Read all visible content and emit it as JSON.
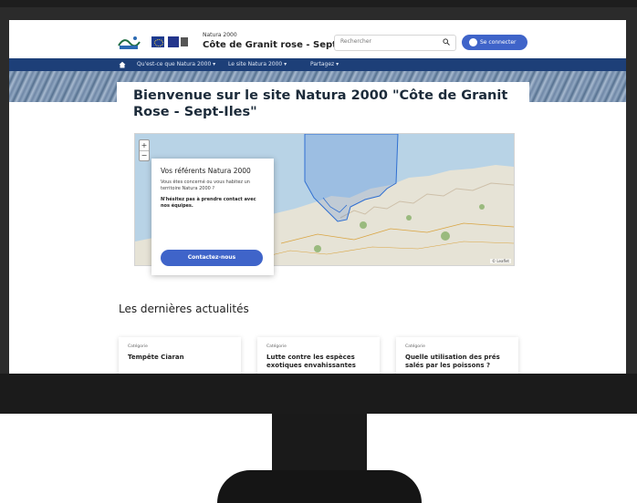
{
  "site": {
    "kicker": "Natura 2000",
    "name": "Côte de Granit rose - Sept-Iles",
    "search_placeholder": "Rechercher",
    "login_label": "Se connecter"
  },
  "nav": {
    "items": [
      "Qu'est-ce que Natura 2000 ▾",
      "Le site Natura 2000 ▾",
      "Partagez ▾"
    ]
  },
  "main": {
    "title": "Bienvenue sur le site Natura 2000 \"Côte de Granit Rose - Sept-Iles\""
  },
  "map": {
    "zoom_in": "+",
    "zoom_out": "−",
    "attribution": "© Leaflet",
    "popup": {
      "title": "Vos référents Natura 2000",
      "text": "Vous êtes concerné ou vous habitez un territoire Natura 2000 ?",
      "strong": "N'hésitez pas à prendre contact avec nos équipes.",
      "button": "Contactez-nous"
    }
  },
  "news": {
    "title": "Les dernières actualités",
    "items": [
      {
        "category": "Catégorie",
        "headline": "Tempête Ciaran"
      },
      {
        "category": "Catégorie",
        "headline": "Lutte contre les espèces exotiques envahissantes"
      },
      {
        "category": "Catégorie",
        "headline": "Quelle utilisation des prés salés par les poissons ?"
      }
    ]
  },
  "colors": {
    "nav": "#1d3f78",
    "accent": "#3f64c9",
    "sea": "#b8d3e6",
    "land": "#e6e3d6",
    "zone": "#2f6fd1"
  },
  "icons": [
    "natura-2000-logo",
    "eu-flag-icon",
    "french-republic-logo",
    "search-icon",
    "user-icon",
    "home-icon"
  ]
}
